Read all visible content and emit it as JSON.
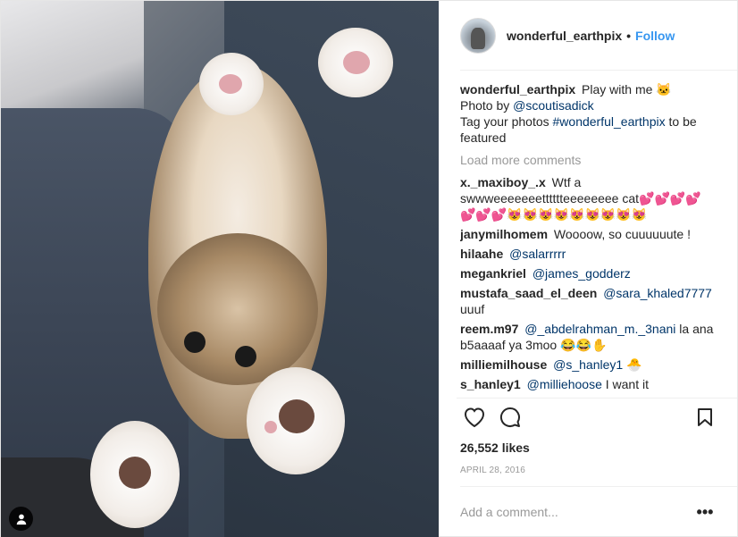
{
  "post": {
    "username": "wonderful_earthpix",
    "follow_label": "Follow",
    "separator": "•",
    "caption": {
      "text": "Play with me 🐱",
      "photo_by_prefix": "Photo by",
      "photo_by_mention": "@scoutisadick",
      "tag_prefix": "Tag your photos",
      "tag": "#wonderful_earthpix",
      "tag_suffix": "to be featured"
    },
    "load_more": "Load more comments",
    "comments": [
      {
        "user": "x._maxiboy_.x",
        "text": "Wtf a swwweeeeeeetttttteeeeeeee cat💕💕💕💕💕💕💕😻😻😻😻😻😻😻😻😻"
      },
      {
        "user": "janymilhomem",
        "text": "Woooow, so cuuuuuute !"
      },
      {
        "user": "hilaahe",
        "mention": "@salarrrrr",
        "text": ""
      },
      {
        "user": "megankriel",
        "mention": "@james_godderz",
        "text": ""
      },
      {
        "user": "mustafa_saad_el_deen",
        "mention": "@sara_khaled7777",
        "text": "uuuf"
      },
      {
        "user": "reem.m97",
        "mention": "@_abdelrahman_m._3nani",
        "text": "la ana b5aaaaf ya 3moo 😂😂✋"
      },
      {
        "user": "milliemilhouse",
        "mention": "@s_hanley1",
        "text": "🐣"
      },
      {
        "user": "s_hanley1",
        "mention": "@milliehoose",
        "text": "I want it"
      }
    ],
    "likes": "26,552 likes",
    "date": "APRIL 28, 2016",
    "add_comment_placeholder": "Add a comment...",
    "more_label": "•••"
  },
  "icons": {
    "like": "heart-icon",
    "comment": "comment-icon",
    "save": "bookmark-icon",
    "user_tag": "user-icon"
  }
}
